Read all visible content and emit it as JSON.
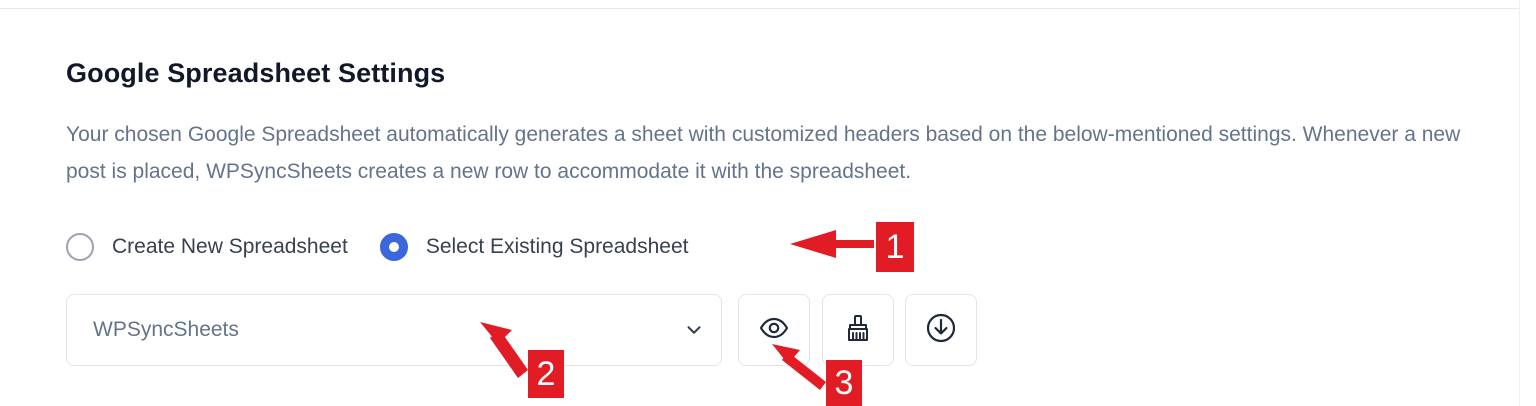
{
  "settings": {
    "title": "Google Spreadsheet Settings",
    "description": "Your chosen Google Spreadsheet automatically generates a sheet with customized headers based on the below-mentioned settings. Whenever a new post is placed, WPSyncSheets creates a new row to accommodate it with the spreadsheet.",
    "radio_options": [
      {
        "label": "Create New Spreadsheet",
        "checked": false
      },
      {
        "label": "Select Existing Spreadsheet",
        "checked": true
      }
    ],
    "spreadsheet_select": {
      "value": "WPSyncSheets",
      "icon": "chevron-down-icon"
    },
    "action_buttons": [
      {
        "name": "view",
        "icon": "eye-icon"
      },
      {
        "name": "clear",
        "icon": "broom-icon"
      },
      {
        "name": "download",
        "icon": "download-icon"
      }
    ]
  },
  "annotations": {
    "callout_1": "1",
    "callout_2": "2",
    "callout_3": "3",
    "color": "#e11c24"
  },
  "theme": {
    "accent": "#3b66dc",
    "muted_text": "#64748b",
    "border": "#e2e5ea"
  }
}
